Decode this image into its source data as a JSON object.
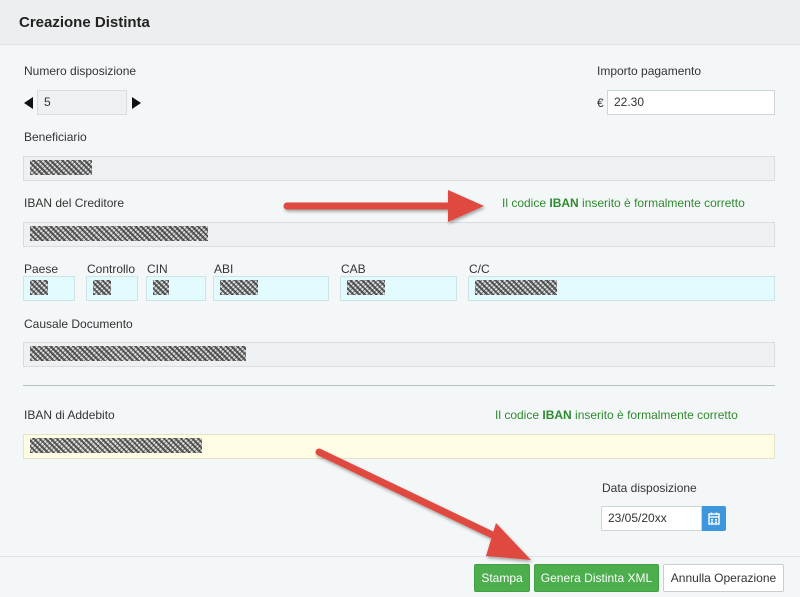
{
  "header": {
    "title": "Creazione Distinta"
  },
  "numero": {
    "label": "Numero disposizione",
    "value": "5"
  },
  "importo": {
    "label": "Importo pagamento",
    "currency": "€",
    "value": "22.30"
  },
  "beneficiario": {
    "label": "Beneficiario"
  },
  "iban_creditore": {
    "label": "IBAN del Creditore",
    "msg_pre": "Il codice ",
    "msg_bold": "IBAN",
    "msg_post": " inserito è formalmente corretto"
  },
  "parts": {
    "paese": "Paese",
    "controllo": "Controllo",
    "cin": "CIN",
    "abi": "ABI",
    "cab": "CAB",
    "cc": "C/C"
  },
  "causale": {
    "label": "Causale Documento"
  },
  "iban_addebito": {
    "label": "IBAN di Addebito",
    "msg_pre": "Il codice ",
    "msg_bold": "IBAN",
    "msg_post": " inserito è formalmente corretto"
  },
  "data": {
    "label": "Data disposizione",
    "value": "23/05/20xx"
  },
  "buttons": {
    "stampa": "Stampa",
    "genera": "Genera Distinta XML",
    "annulla": "Annulla Operazione"
  },
  "colors": {
    "accent_green": "#4cae4c",
    "valid_text": "#2f8a2f",
    "calendar_blue": "#3c97dc",
    "arrow_red": "#e04a3f"
  },
  "icons": {
    "calendar": "calendar-icon",
    "prev": "triangle-left-icon",
    "next": "triangle-right-icon"
  }
}
